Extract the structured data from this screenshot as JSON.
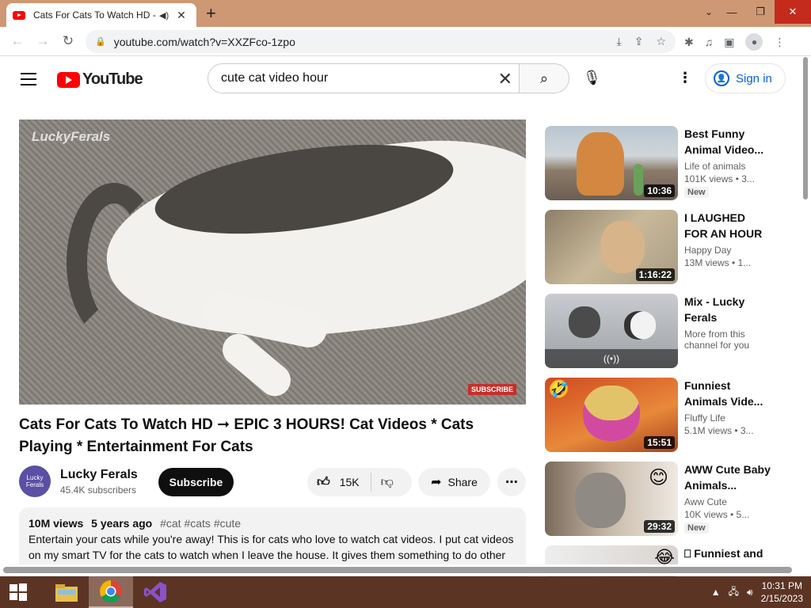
{
  "browser": {
    "tab_title": "Cats For Cats To Watch HD -",
    "url": "youtube.com/watch?v=XXZFco-1zpo"
  },
  "youtube": {
    "logo_text": "YouTube",
    "search_value": "cute cat video hour",
    "signin_label": "Sign in"
  },
  "video": {
    "watermark": "LuckyFerals",
    "subscribe_badge": "SUBSCRIBE",
    "title": "Cats For Cats To Watch HD ➞ EPIC 3 HOURS! Cat Videos * Cats Playing * Entertainment For Cats",
    "channel": "Lucky Ferals",
    "channel_avatar_text": "Lucky Ferals",
    "subscribers": "45.4K subscribers",
    "subscribe_label": "Subscribe",
    "likes": "15K",
    "share_label": "Share",
    "views": "10M views",
    "age": "5 years ago",
    "tags": "#cat #cats #cute",
    "description": "Entertain your cats while you're away! This is for cats who love to watch cat videos. I put cat videos on my smart TV for the cats to watch when I leave the house. It gives them something to do other"
  },
  "sidebar": [
    {
      "title": "Best Funny Animal Video...",
      "channel": "Life of animals",
      "views": "101K views • 3...",
      "badge": "New",
      "duration": "10:36"
    },
    {
      "title": "I LAUGHED FOR AN HOUR😹...",
      "channel": "Happy Day",
      "views": "13M views • 1...",
      "badge": "",
      "duration": "1:16:22"
    },
    {
      "title": "Mix - Lucky Ferals",
      "channel": "More from this channel for you",
      "views": "",
      "badge": "",
      "duration": "",
      "mix_icon": "((•))"
    },
    {
      "title": "Funniest Animals Vide...",
      "channel": "Fluffy Life",
      "views": "5.1M views • 3...",
      "badge": "",
      "duration": "15:51"
    },
    {
      "title": "AWW Cute Baby Animals...",
      "channel": "Aww Cute",
      "views": "10K views • 5...",
      "badge": "New",
      "duration": "29:32"
    },
    {
      "title": "⎕ Funniest and Most Hilariou...",
      "channel": "",
      "views": "",
      "badge": "",
      "duration": ""
    }
  ],
  "taskbar": {
    "time": "10:31 PM",
    "date": "2/15/2023"
  }
}
